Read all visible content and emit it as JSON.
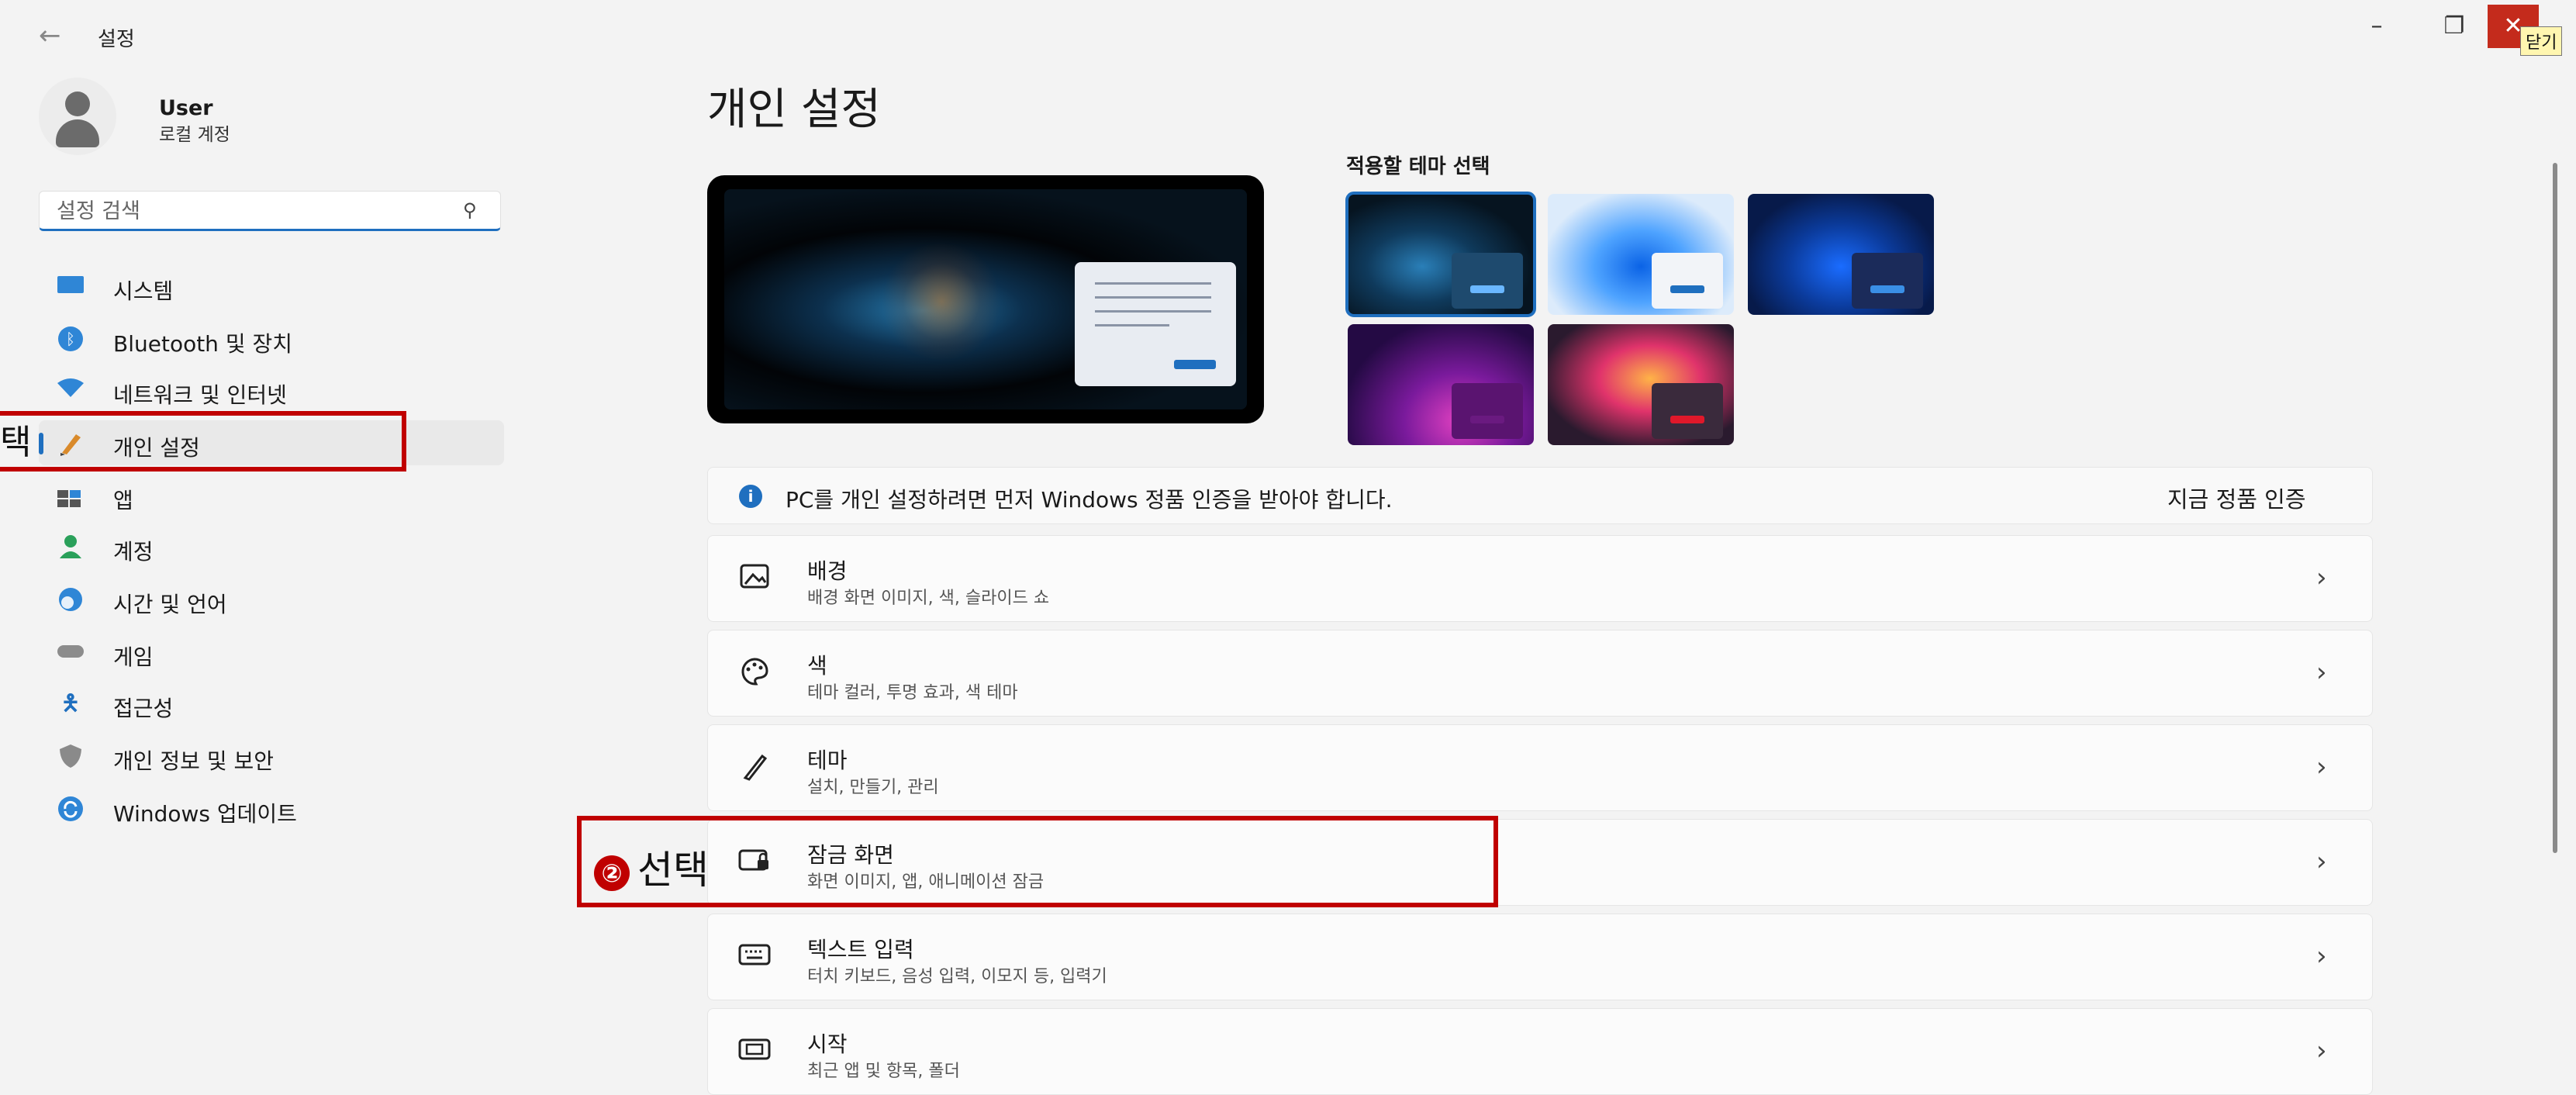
{
  "titlebar": {
    "back_icon": "arrow-left-icon",
    "title": "설정",
    "close_tooltip": "닫기"
  },
  "profile": {
    "name": "User",
    "account": "로컬 계정"
  },
  "search": {
    "placeholder": "설정 검색",
    "value": ""
  },
  "sidebar": {
    "items": [
      {
        "label": "시스템",
        "icon": "monitor-icon"
      },
      {
        "label": "Bluetooth 및 장치",
        "icon": "bluetooth-icon"
      },
      {
        "label": "네트워크 및 인터넷",
        "icon": "wifi-icon"
      },
      {
        "label": "개인 설정",
        "icon": "brush-icon",
        "active": true
      },
      {
        "label": "앱",
        "icon": "apps-icon"
      },
      {
        "label": "계정",
        "icon": "person-icon"
      },
      {
        "label": "시간 및 언어",
        "icon": "globe-clock-icon"
      },
      {
        "label": "게임",
        "icon": "gamepad-icon"
      },
      {
        "label": "접근성",
        "icon": "accessibility-icon"
      },
      {
        "label": "개인 정보 및 보안",
        "icon": "shield-icon"
      },
      {
        "label": "Windows 업데이트",
        "icon": "update-icon"
      }
    ]
  },
  "annotations": {
    "step1": "택",
    "step2_num": "②",
    "step2_text": "선택"
  },
  "main": {
    "title": "개인 설정",
    "theme_label": "적용할 테마 선택",
    "notice": {
      "text": "PC를 개인 설정하려면 먼저 Windows 정품 인증을 받아야 합니다.",
      "link": "지금 정품 인증"
    },
    "cards": [
      {
        "title": "배경",
        "subtitle": "배경 화면 이미지, 색, 슬라이드 쇼",
        "icon": "image-icon"
      },
      {
        "title": "색",
        "subtitle": "테마 컬러, 투명 효과, 색 테마",
        "icon": "palette-icon"
      },
      {
        "title": "테마",
        "subtitle": "설치, 만들기, 관리",
        "icon": "brush-icon"
      },
      {
        "title": "잠금 화면",
        "subtitle": "화면 이미지, 앱, 애니메이션 잠금",
        "icon": "lock-screen-icon"
      },
      {
        "title": "텍스트 입력",
        "subtitle": "터치 키보드, 음성 입력, 이모지 등, 입력기",
        "icon": "keyboard-icon"
      },
      {
        "title": "시작",
        "subtitle": "최근 앱 및 항목, 폴더",
        "icon": "start-icon"
      }
    ]
  },
  "colors": {
    "accent": "#1f6fbf",
    "highlight": "#c00000",
    "close_red": "#c42b1c"
  }
}
